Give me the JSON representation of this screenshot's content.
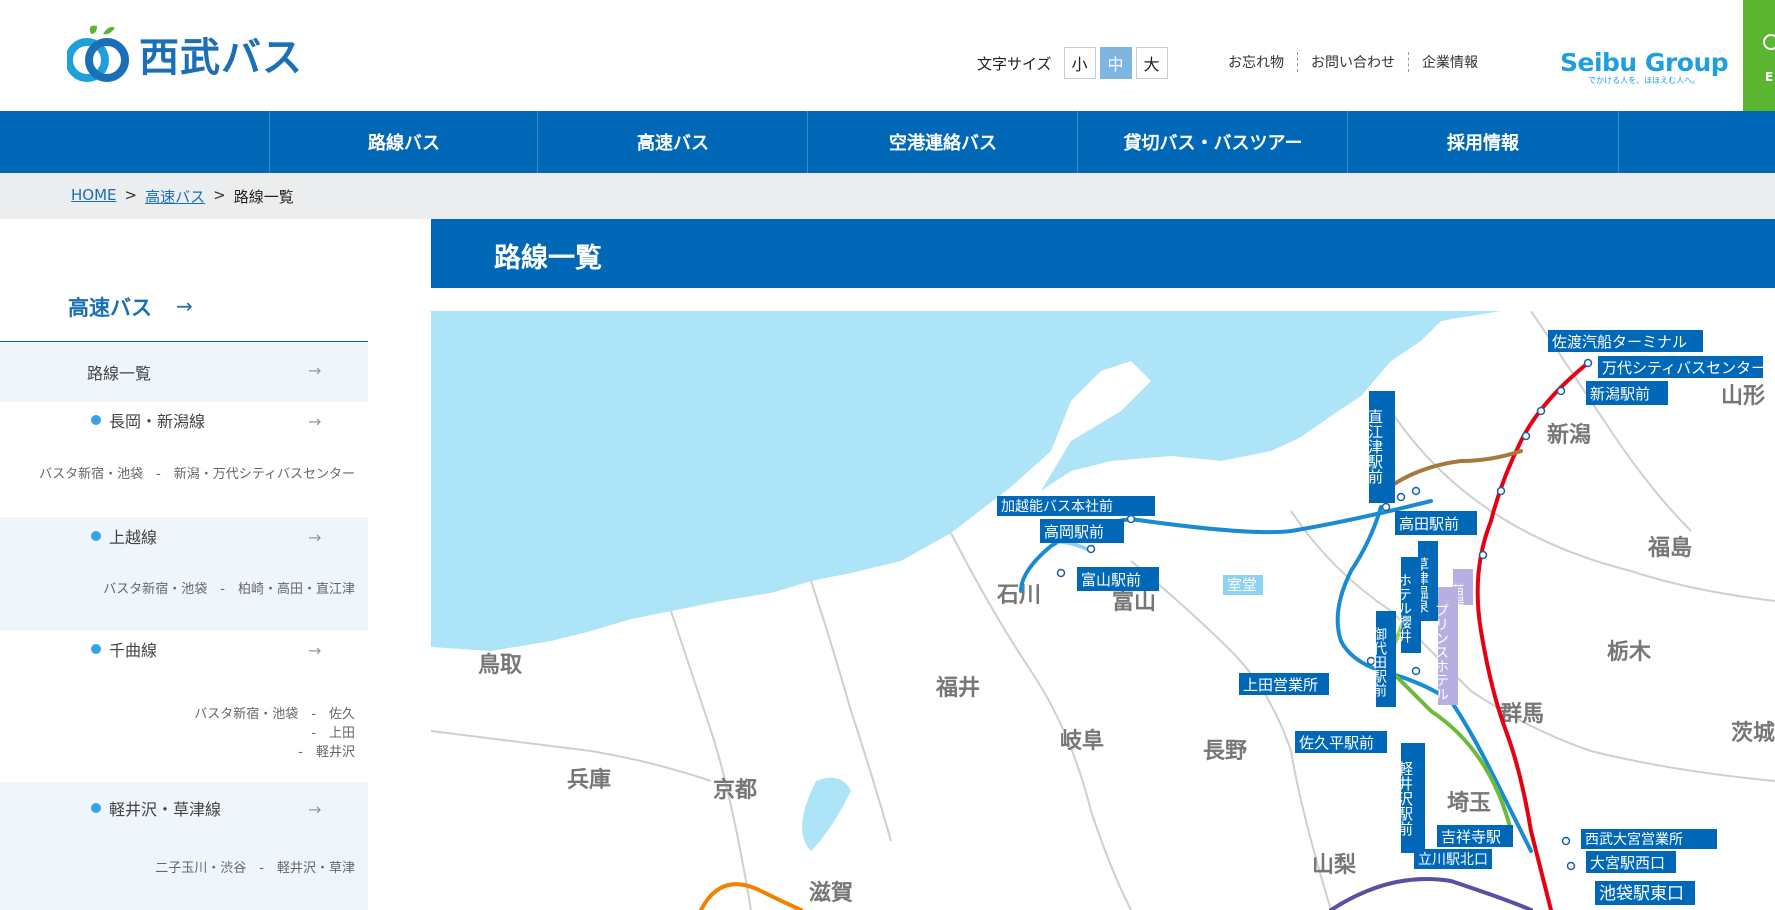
{
  "header": {
    "logo_text": "西武バス",
    "font_size_label": "文字サイズ",
    "font_sizes": [
      "小",
      "中",
      "大"
    ],
    "util_links": [
      "お忘れ物",
      "お問い合わせ",
      "企業情報"
    ],
    "group_logo": "Seibu Group",
    "group_tagline": "でかける人を、ほほえむ人へ。",
    "english_label": "E"
  },
  "nav": [
    "路線バス",
    "高速バス",
    "空港連絡バス",
    "貸切バス・バスツアー",
    "採用情報"
  ],
  "breadcrumb": {
    "home": "HOME",
    "sep": ">",
    "level2": "高速バス",
    "current": "路線一覧"
  },
  "sidebar": {
    "title": "高速バス",
    "items": [
      {
        "label": "路線一覧"
      },
      {
        "label": "長岡・新潟線",
        "desc": "バスタ新宿・池袋　-　新潟・万代シティバスセンター"
      },
      {
        "label": "上越線",
        "desc": "バスタ新宿・池袋　-　柏崎・高田・直江津"
      },
      {
        "label": "千曲線",
        "desc_lines": [
          "バスタ新宿・池袋　-　佐久",
          "-　上田",
          "-　軽井沢"
        ]
      },
      {
        "label": "軽井沢・草津線",
        "desc": "二子玉川・渋谷　-　軽井沢・草津"
      }
    ]
  },
  "main": {
    "title": "路線一覧"
  },
  "map": {
    "prefectures": [
      "山形",
      "新潟",
      "福島",
      "石川",
      "富山",
      "栃木",
      "鳥取",
      "福井",
      "群馬",
      "茨城",
      "岐阜",
      "長野",
      "兵庫",
      "京都",
      "埼玉",
      "山梨",
      "滋賀"
    ],
    "stations": [
      "佐渡汽船ターミナル",
      "万代シティバスセンター",
      "新潟駅前",
      "直江津駅前",
      "加越能バス本社前",
      "高岡駅前",
      "高田駅前",
      "富山駅前",
      "室堂",
      "草津温泉",
      "苗場",
      "ホテル櫻井",
      "プリンスホテル",
      "御代田駅前",
      "上田営業所",
      "佐久平駅前",
      "軽井沢駅前",
      "吉祥寺駅",
      "西武大宮営業所",
      "大宮駅西口",
      "立川駅北口",
      "池袋駅東口"
    ],
    "colors": {
      "sea": "#aee4f7",
      "land": "#ffffff",
      "route_red": "#e60012",
      "route_blue": "#1a8bd0",
      "route_green": "#6cbb3c",
      "route_orange": "#f08300",
      "route_purple": "#5a4fa2"
    }
  },
  "colors": {
    "brand_blue": "#0068b7",
    "english_green": "#5cb531",
    "breadcrumb_bg": "#ebedef"
  }
}
